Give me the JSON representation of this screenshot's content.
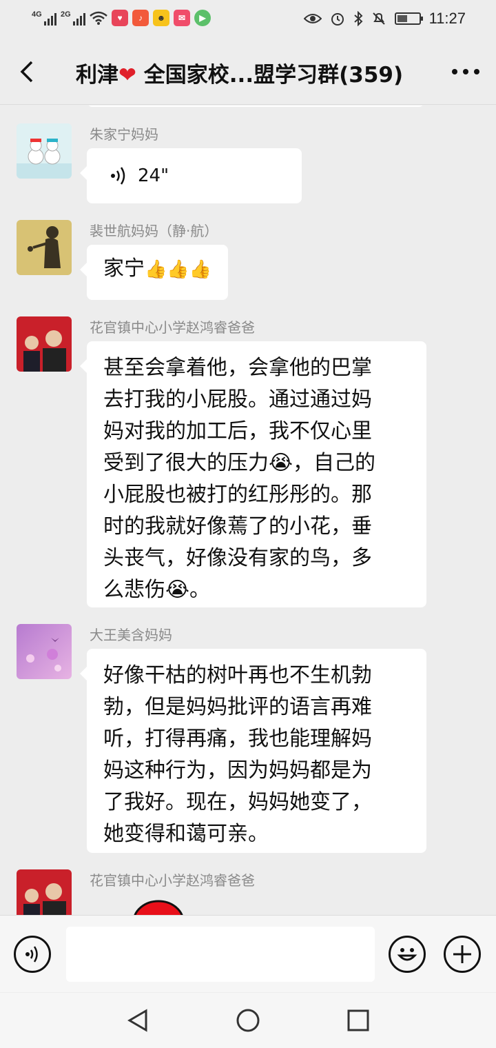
{
  "status_bar": {
    "network_1": "4G",
    "network_2": "2G",
    "time": "11:27",
    "battery_level": 0.55
  },
  "header": {
    "title_prefix": "利津",
    "title_rest": " 全国家校...盟学习群(359)",
    "back_icon": "chevron-left-icon",
    "more_icon": "more-dots-icon"
  },
  "messages": [
    {
      "sender": "朱家宁妈妈",
      "type": "voice",
      "duration": "24\""
    },
    {
      "sender": "裴世航妈妈（静·航）",
      "type": "text",
      "text": "家宁",
      "emoji": "👍👍👍"
    },
    {
      "sender": "花官镇中心小学赵鸿睿爸爸",
      "type": "text",
      "lines": [
        "甚至会拿着他，会拿他的巴掌",
        "去打我的小屁股。通过通过妈",
        "妈对我的加工后，我不仅心里",
        "受到了很大的压力😭，自己的",
        "小屁股也被打的红彤彤的。那",
        "时的我就好像蔫了的小花，垂",
        "头丧气，好像没有家的鸟，多",
        "么悲伤😭。"
      ]
    },
    {
      "sender": "大王美含妈妈",
      "type": "text",
      "lines": [
        "好像干枯的树叶再也不生机勃",
        "勃，但是妈妈批评的语言再难",
        "听，打得再痛，我也能理解妈",
        "妈这种行为，因为妈妈都是为",
        "了我好。现在，妈妈她变了，",
        "她变得和蔼可亲。"
      ]
    },
    {
      "sender": "花官镇中心小学赵鸿睿爸爸",
      "type": "image"
    }
  ],
  "composer": {
    "voice_icon": "voice-toggle-icon",
    "emoji_icon": "emoji-icon",
    "plus_icon": "plus-icon"
  },
  "navbar": {
    "back": "nav-back-icon",
    "home": "nav-home-icon",
    "recents": "nav-recents-icon"
  }
}
